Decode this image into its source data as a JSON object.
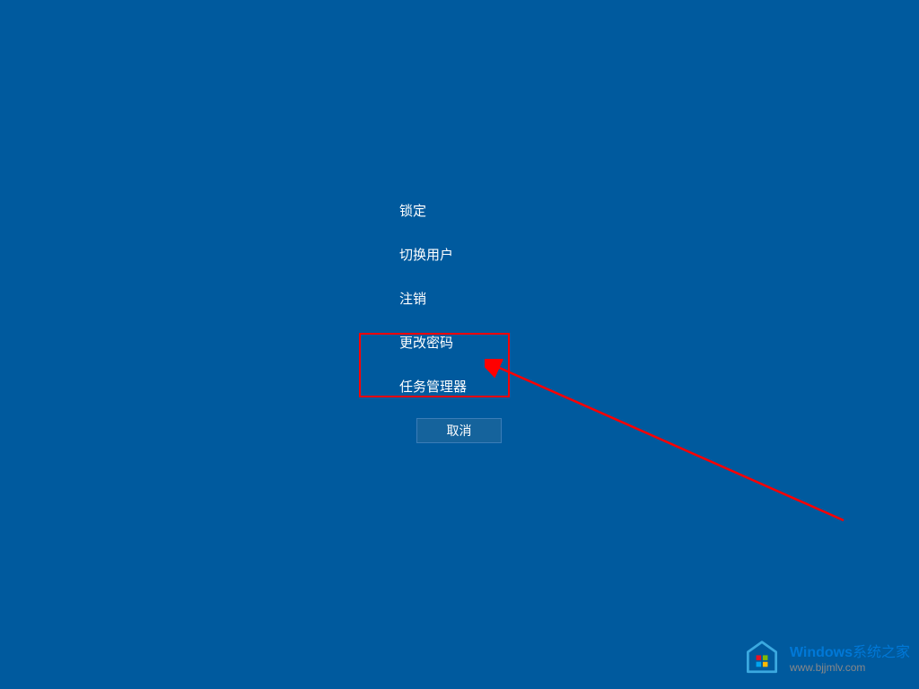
{
  "menu": {
    "items": [
      {
        "label": "锁定"
      },
      {
        "label": "切换用户"
      },
      {
        "label": "注销"
      },
      {
        "label": "更改密码"
      },
      {
        "label": "任务管理器"
      }
    ]
  },
  "cancel_button": {
    "label": "取消"
  },
  "watermark": {
    "brand": "Windows",
    "title": "系统之家",
    "url": "www.bjjmlv.com"
  },
  "annotation": {
    "highlighted_item_index": 4,
    "arrow_color": "#ff0000"
  }
}
